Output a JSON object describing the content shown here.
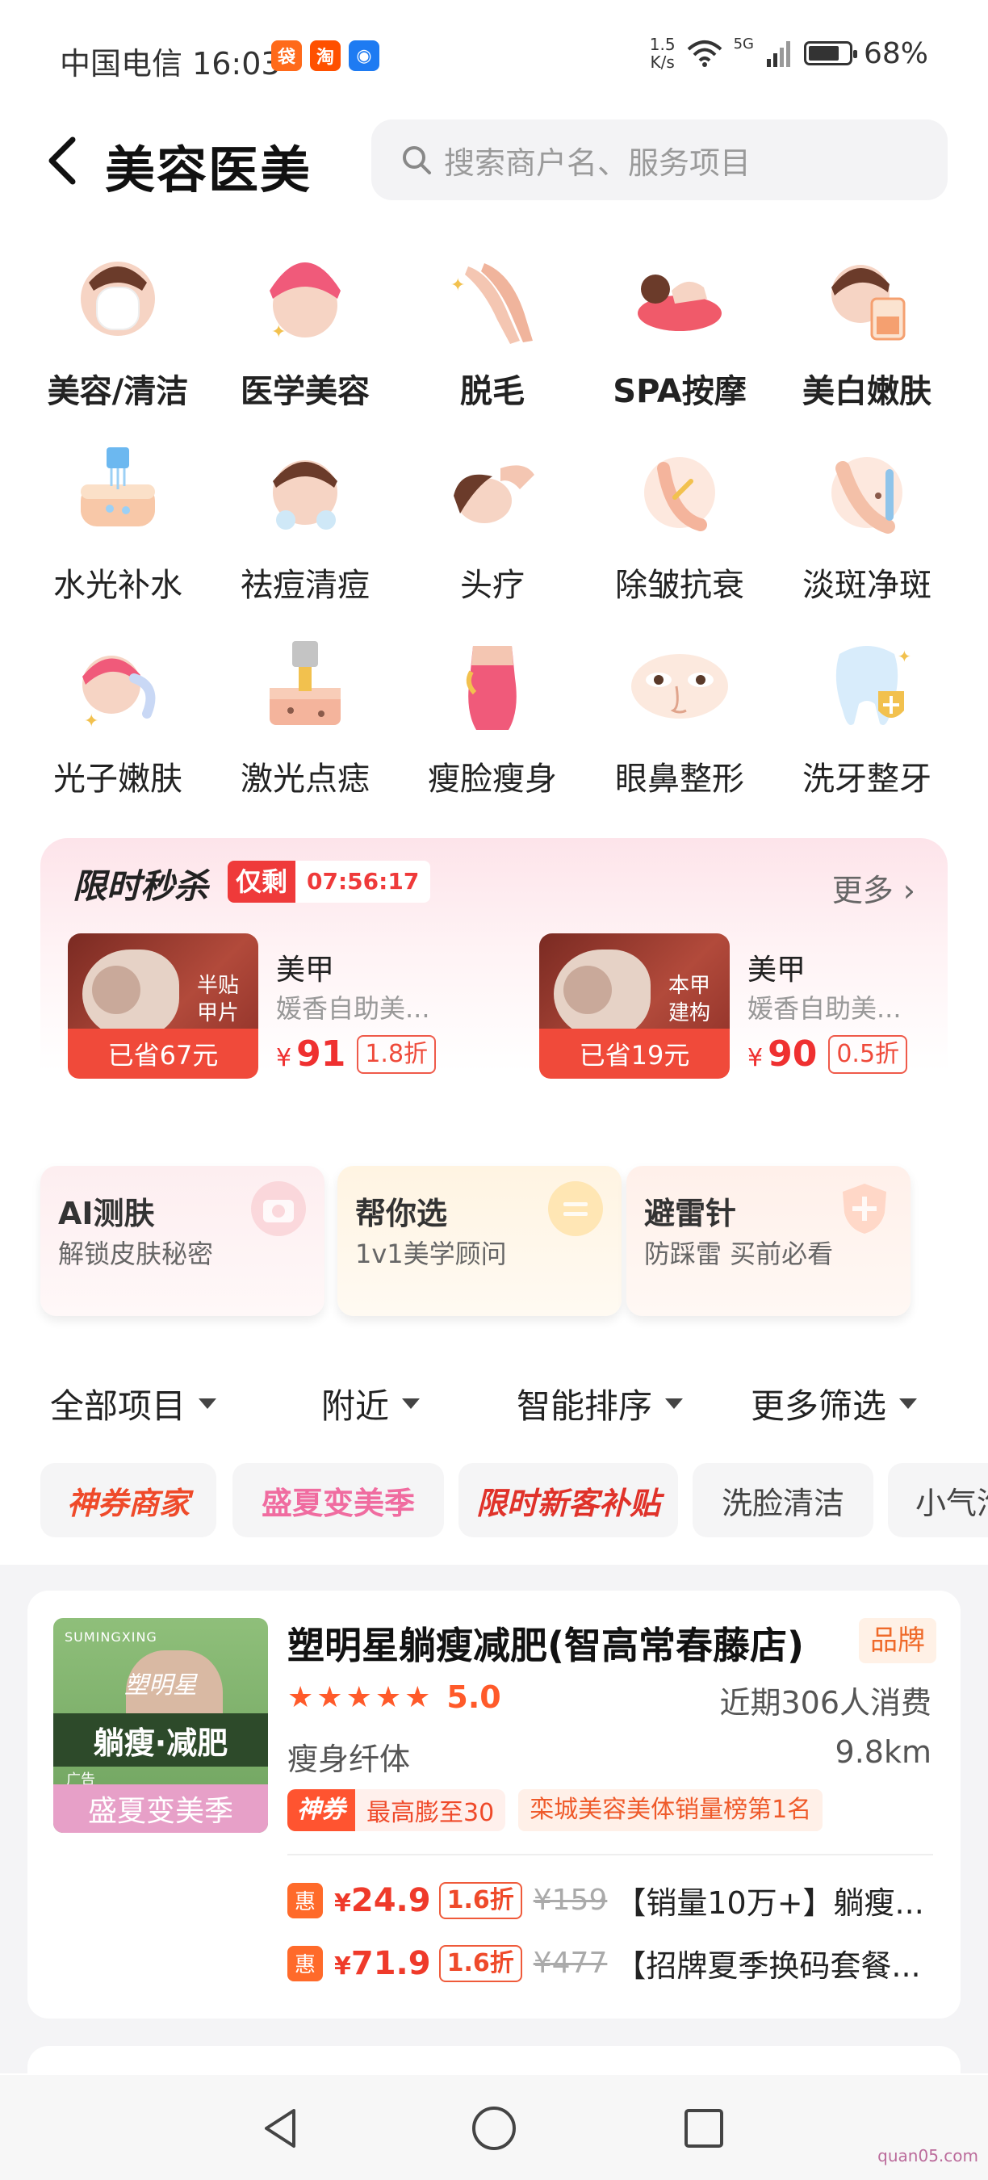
{
  "status_bar": {
    "carrier_time": "中国电信 16:03",
    "apps": [
      {
        "icon": "meituan-app-icon",
        "glyph": "袋",
        "color": "#ff6a1a"
      },
      {
        "icon": "taobao-app-icon",
        "glyph": "淘",
        "color": "#ff5000"
      },
      {
        "icon": "messenger-app-icon",
        "glyph": "◉",
        "color": "#1e7bf2"
      }
    ],
    "speed_value": "1.5",
    "speed_unit": "K/s",
    "network": "5G",
    "battery": "68%",
    "battery_level": 0.68
  },
  "header": {
    "title": "美容医美",
    "search_placeholder": "搜索商户名、服务项目"
  },
  "categories": [
    {
      "label": "美容/清洁",
      "icon": "face-mask-icon",
      "bold": true
    },
    {
      "label": "医学美容",
      "icon": "face-towel-icon",
      "bold": true
    },
    {
      "label": "脱毛",
      "icon": "legs-icon",
      "bold": true
    },
    {
      "label": "SPA按摩",
      "icon": "massage-icon",
      "bold": true
    },
    {
      "label": "美白嫩肤",
      "icon": "whitening-icon",
      "bold": true
    },
    {
      "label": "水光补水",
      "icon": "hydration-icon",
      "bold": false
    },
    {
      "label": "祛痘清痘",
      "icon": "acne-icon",
      "bold": false
    },
    {
      "label": "头疗",
      "icon": "head-spa-icon",
      "bold": false
    },
    {
      "label": "除皱抗衰",
      "icon": "anti-wrinkle-icon",
      "bold": false
    },
    {
      "label": "淡斑净斑",
      "icon": "spot-removal-icon",
      "bold": false
    },
    {
      "label": "光子嫩肤",
      "icon": "photon-icon",
      "bold": false
    },
    {
      "label": "激光点痣",
      "icon": "laser-icon",
      "bold": false
    },
    {
      "label": "瘦脸瘦身",
      "icon": "slimming-icon",
      "bold": false
    },
    {
      "label": "眼鼻整形",
      "icon": "eyes-nose-icon",
      "bold": false
    },
    {
      "label": "洗牙整牙",
      "icon": "tooth-icon",
      "bold": false
    }
  ],
  "flash_sale": {
    "title": "限时秒杀",
    "tag_label": "仅剩",
    "countdown": "07:56:17",
    "more": "更多",
    "deals": [
      {
        "name": "美甲",
        "shop": "媛香自助美...",
        "saved": "已省67元",
        "yen": "¥",
        "price": "91",
        "discount": "1.8折",
        "img_text": "半贴甲片"
      },
      {
        "name": "美甲",
        "shop": "媛香自助美...",
        "saved": "已省19元",
        "yen": "¥",
        "price": "90",
        "discount": "0.5折",
        "img_text": "本甲建构"
      }
    ]
  },
  "tools": [
    {
      "title": "AI测肤",
      "sub": "解锁皮肤秘密",
      "icon": "camera-icon",
      "bg": "#fdeef0",
      "accent": "#f7c4c8"
    },
    {
      "title": "帮你选",
      "sub": "1v1美学顾问",
      "icon": "equal-circle-icon",
      "bg": "#fff4e2",
      "accent": "#ffd98a"
    },
    {
      "title": "避雷针",
      "sub": "防踩雷 买前必看",
      "icon": "shield-plus-icon",
      "bg": "#fff0ea",
      "accent": "#ffc2aa"
    }
  ],
  "filters": [
    "全部项目",
    "附近",
    "智能排序",
    "更多筛选"
  ],
  "chips": [
    {
      "label": "神券商家",
      "style": "brand1"
    },
    {
      "label": "盛夏变美季",
      "style": "brand2"
    },
    {
      "label": "限时新客补贴",
      "style": "brand3"
    },
    {
      "label": "洗脸清洁",
      "style": ""
    },
    {
      "label": "小气泡",
      "style": ""
    }
  ],
  "shop": {
    "name": "塑明星躺瘦减肥(智高常春藤店)",
    "brand_tag": "品牌",
    "rating": "5.0",
    "rating_stars": 5,
    "consumed": "近期306人消费",
    "category": "瘦身纤体",
    "distance": "9.8km",
    "coupon_tag": "神券",
    "coupon_text": "最高膨至30",
    "rank": "栾城美容美体销量榜第1名",
    "image": {
      "brand": "SUMINGXING",
      "name": "塑明星",
      "slogan": "躺瘦·减肥",
      "ad": "广告",
      "campaign": "盛夏变美季"
    },
    "offers": [
      {
        "badge": "惠",
        "yen": "¥",
        "price": "24.9",
        "discount": "1.6折",
        "original": "¥159",
        "title": "【销量10万+】躺瘦..."
      },
      {
        "badge": "惠",
        "yen": "¥",
        "price": "71.9",
        "discount": "1.6折",
        "original": "¥477",
        "title": "【招牌夏季换码套餐..."
      }
    ]
  },
  "watermark": "quan05.com"
}
